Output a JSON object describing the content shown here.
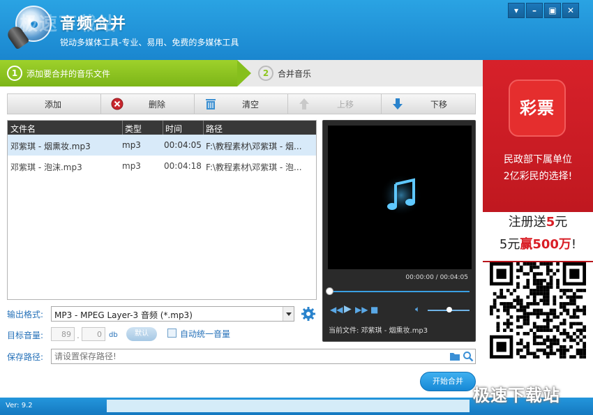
{
  "app": {
    "name": "音频合并",
    "slogan": "锐动多媒体工具-专业、易用、免费的多媒体工具",
    "watermark": "极速下载站",
    "version": "Ver: 9.2"
  },
  "window_controls": {
    "menu": "▾",
    "minimize": "–",
    "maximize": "▣",
    "close": "✕"
  },
  "steps": [
    {
      "num": "1",
      "label": "添加要合并的音乐文件",
      "active": true
    },
    {
      "num": "2",
      "label": "合并音乐",
      "active": false
    }
  ],
  "toolbar": {
    "add": "添加",
    "delete": "删除",
    "clear": "清空",
    "move_up": "上移",
    "move_down": "下移"
  },
  "file_list": {
    "columns": [
      "文件名",
      "类型",
      "时间",
      "路径"
    ],
    "rows": [
      {
        "name": "邓紫琪 - 烟熏妆.mp3",
        "type": "mp3",
        "time": "00:04:05",
        "path": "F:\\教程素材\\邓紫琪 - 烟...",
        "selected": true
      },
      {
        "name": "邓紫琪 - 泡沫.mp3",
        "type": "mp3",
        "time": "00:04:18",
        "path": "F:\\教程素材\\邓紫琪 - 泡...",
        "selected": false
      }
    ]
  },
  "player": {
    "time": "00:00:00 / 00:04:05",
    "current_file": "当前文件: 邓紫琪 - 烟熏妆.mp3",
    "seek_fraction": 0,
    "volume_fraction": 0.5
  },
  "settings": {
    "format_label": "输出格式:",
    "format_value": "MP3 - MPEG Layer-3 音频 (*.mp3)",
    "volume_label": "目标音量:",
    "volume_int": "89",
    "volume_dec": "0",
    "volume_sep": ".",
    "volume_unit": "db",
    "default_button": "默认",
    "normalize_label": "自动统一音量",
    "normalize_checked": false,
    "save_label": "保存路径:",
    "save_placeholder": "请设置保存路径!"
  },
  "actions": {
    "start": "开始合并"
  },
  "ad": {
    "logo_text": "彩票",
    "line1": "民政部下属单位",
    "line2": "2亿彩民的选择!",
    "promo1_a": "注册送",
    "promo1_b": "5",
    "promo1_c": "元",
    "promo2_a": "5元",
    "promo2_b": "赢500万",
    "promo2_c": "!"
  },
  "colors": {
    "title_bar": "#1a86cf",
    "step_active": "#8ec521",
    "accent": "#2470b8",
    "ad_red": "#d91e26"
  }
}
